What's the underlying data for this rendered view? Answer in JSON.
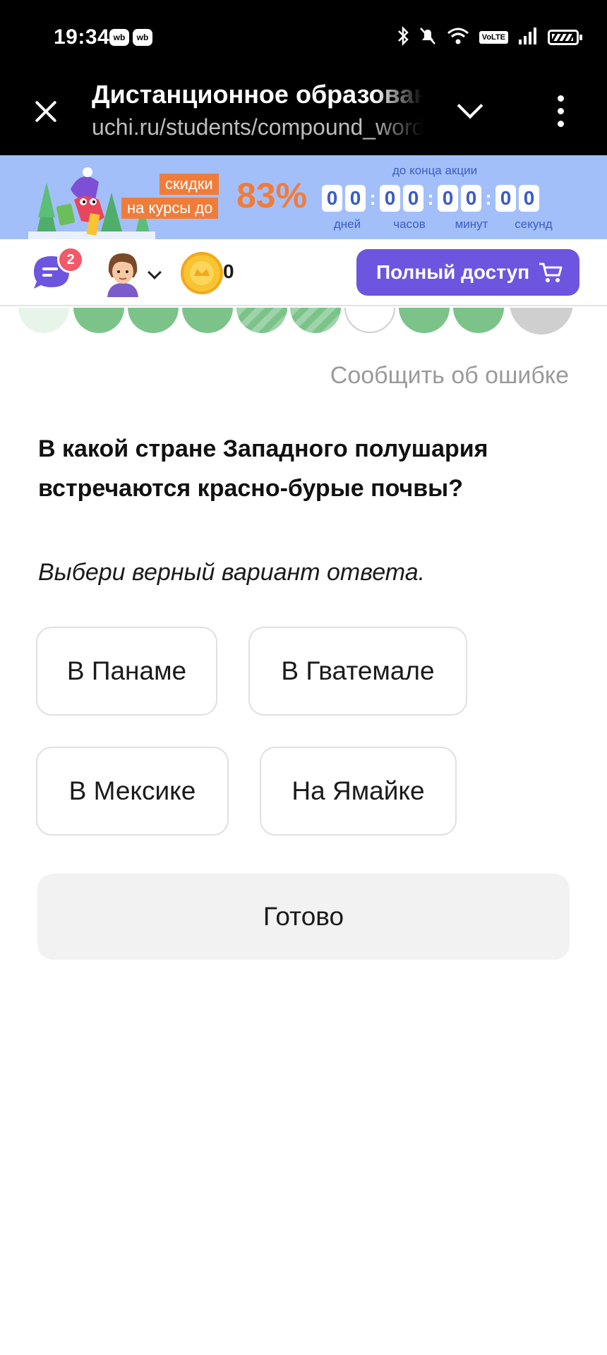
{
  "status_bar": {
    "time": "19:34",
    "app_icons": [
      "wb",
      "wb"
    ],
    "network": "VoLTE"
  },
  "browser": {
    "title": "Дистанционное образование",
    "url": "uchi.ru/students/compound_words"
  },
  "promo": {
    "tag_line1": "скидки",
    "tag_line2": "на курсы до",
    "discount": "83%",
    "until_label": "до конца акции",
    "countdown_digits": [
      "0",
      "0",
      "0",
      "0",
      "0",
      "0",
      "0",
      "0"
    ],
    "countdown_labels": [
      "дней",
      "часов",
      "минут",
      "секунд"
    ],
    "colors": {
      "background": "#a3bffa",
      "accent": "#f07c3a",
      "digits": "#3b5cc2"
    }
  },
  "toolbar": {
    "chat_badge_count": "2",
    "coins": "0",
    "full_access_label": "Полный доступ",
    "accent": "#6d55e0"
  },
  "task": {
    "report_error": "Сообщить об ошибке",
    "question": "В какой стране Западного полушария встречаются красно-бурые почвы?",
    "instruction": "Выбери верный вариант ответа.",
    "answers": [
      "В Панаме",
      "В Гватемале",
      "В Мексике",
      "На Ямайке"
    ],
    "submit_label": "Готово"
  }
}
